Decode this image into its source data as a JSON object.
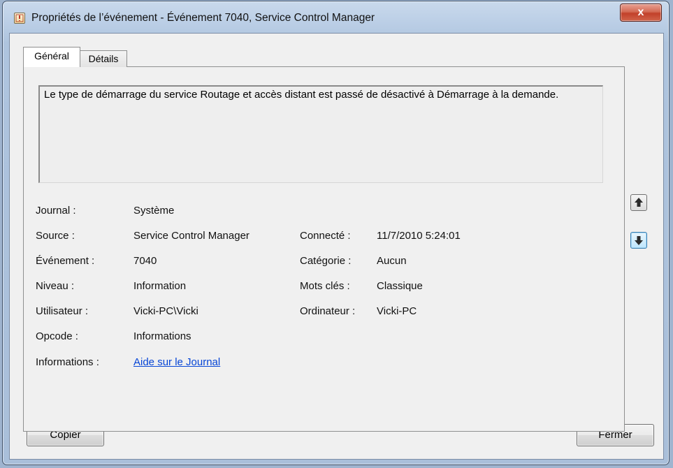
{
  "window": {
    "title": "Propriétés de l’événement - Événement 7040, Service Control Manager",
    "close_label": "x"
  },
  "tabs": [
    {
      "label": "Général",
      "active": true
    },
    {
      "label": "Détails",
      "active": false
    }
  ],
  "description": "Le type de démarrage du service Routage et accès distant est passé de désactivé à Démarrage à la demande.",
  "fields": {
    "journal": {
      "label": "Journal :",
      "value": "Système"
    },
    "source": {
      "label": "Source :",
      "value": "Service Control Manager"
    },
    "evenement": {
      "label": "Événement :",
      "value": "7040"
    },
    "niveau": {
      "label": "Niveau :",
      "value": "Information"
    },
    "utilisateur": {
      "label": "Utilisateur :",
      "value": "Vicki-PC\\Vicki"
    },
    "opcode": {
      "label": "Opcode :",
      "value": "Informations"
    },
    "informations": {
      "label": "Informations :",
      "value": "Aide sur le Journal"
    },
    "connecte": {
      "label": "Connecté :",
      "value": "11/7/2010 5:24:01"
    },
    "categorie": {
      "label": "Catégorie :",
      "value": "Aucun"
    },
    "mots_cles": {
      "label": "Mots clés :",
      "value": "Classique"
    },
    "ordinateur": {
      "label": "Ordinateur :",
      "value": "Vicki-PC"
    }
  },
  "buttons": {
    "copy_label": "Copier",
    "close_label": "Fermer"
  },
  "icons": {
    "up": "arrow-up-icon",
    "down": "arrow-down-icon",
    "app": "event-viewer-icon"
  }
}
